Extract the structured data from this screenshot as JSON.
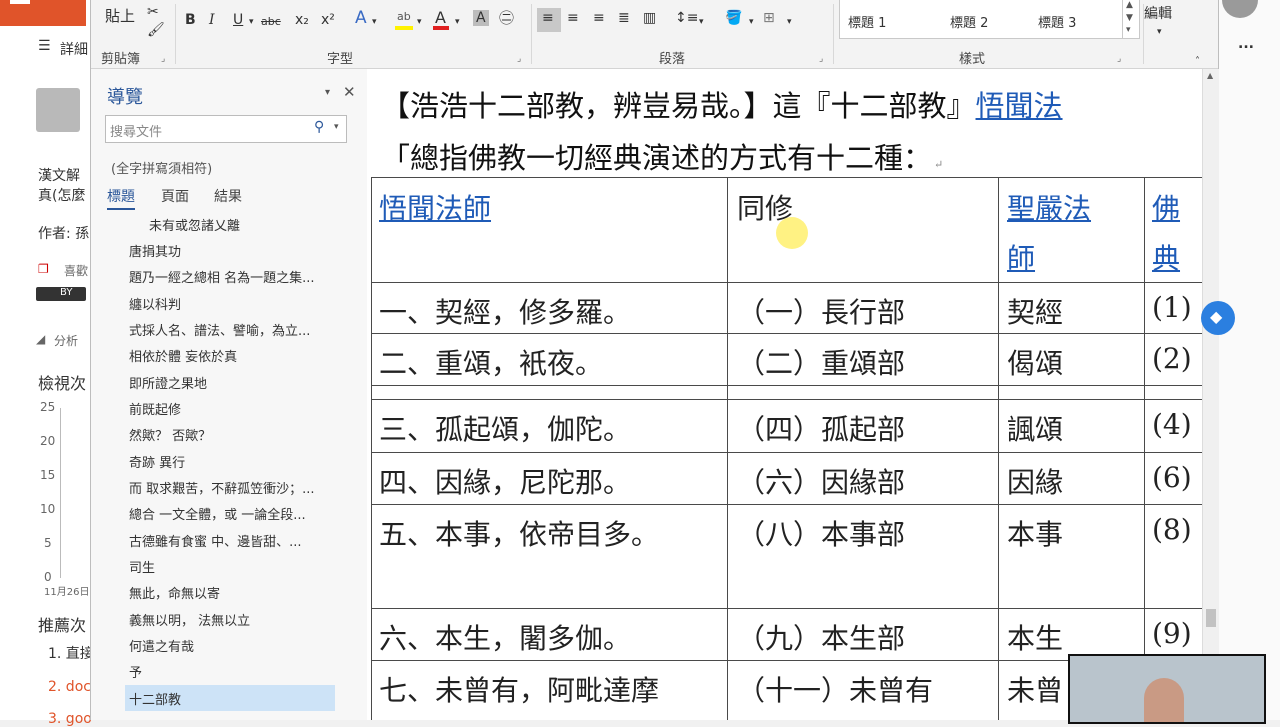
{
  "background_page": {
    "top_label": "詳細",
    "author_line1": "漢文解",
    "author_line2": "真(怎麼",
    "author_label": "作者: 孫",
    "like": "喜歡",
    "license": "BY",
    "analysis": "分析",
    "views": "檢視次",
    "chart_ticks": [
      "25",
      "20",
      "15",
      "10",
      "5",
      "0"
    ],
    "chart_date": "11月26日",
    "recommend": "推薦次",
    "rec_items": [
      "1. 直接",
      "2. doc",
      "3. goo"
    ],
    "more_icon": "..."
  },
  "ribbon": {
    "paste": "貼上",
    "clipboard": "剪貼簿",
    "font_group": "字型",
    "paragraph_group": "段落",
    "styles_group": "樣式",
    "editing": "編輯",
    "font_buttons": [
      "B",
      "I",
      "U",
      "abc",
      "x₂",
      "x²"
    ],
    "style_items": [
      "標題 1",
      "標題 2",
      "標題 3"
    ]
  },
  "nav": {
    "title": "導覽",
    "search_placeholder": "搜尋文件",
    "hint": "(全字拼寫須相符)",
    "tabs": [
      "標題",
      "頁面",
      "結果"
    ],
    "items": [
      "未有或忽諸乂離",
      "唐捐其功",
      "題乃一經之總相 名為一題之集...",
      "纏以科判",
      "式採人名、譜法、譬喻，為立...",
      "相依於體 妄依於真",
      "即所證之果地",
      "前既起修",
      "然歟？ 否歟？",
      "奇跡 異行",
      "而 取求艱苦，不辭孤笠衝沙；...",
      "總合 一文全體，或 一論全段...",
      "古德雖有食蜜 中、邊皆甜、...",
      "司生",
      "無此，命無以寄",
      "義無以明， 法無以立",
      "何遣之有哉",
      "予",
      "十二部教"
    ],
    "selected_index": 18
  },
  "document": {
    "line1_a": "【浩浩十二部教，辨豈易哉。】這『十二部教』",
    "line1_link": "悟聞法",
    "line2": "「總指佛教一切經典演述的方式有十二種：",
    "headers": [
      "悟聞法師",
      "同修",
      "聖嚴法",
      "師",
      "佛",
      "典"
    ],
    "rows": [
      [
        "一、契經，修多羅。",
        "（一）長行部",
        "契經",
        "(1)"
      ],
      [
        "二、重頌，衹夜。",
        "（二）重頌部",
        "偈頌",
        "(2)"
      ],
      [
        "三、孤起頌，伽陀。",
        "（四）孤起部",
        "諷頌",
        "(4)"
      ],
      [
        "四、因緣，尼陀那。",
        "（六）因緣部",
        "因緣",
        "(6)"
      ],
      [
        "五、本事，依帝目多。",
        "（八）本事部",
        "本事",
        "(8)"
      ],
      [
        "六、本生，闍多伽。",
        "（九）本生部",
        "本生",
        "(9)"
      ],
      [
        "七、未曾有，阿毗達摩",
        "（十一）未曾有",
        "未曾",
        ""
      ]
    ]
  },
  "colors": {
    "accent": "#2b579a",
    "link": "#1f5bb7",
    "dropbox": "#2b7fe0"
  }
}
